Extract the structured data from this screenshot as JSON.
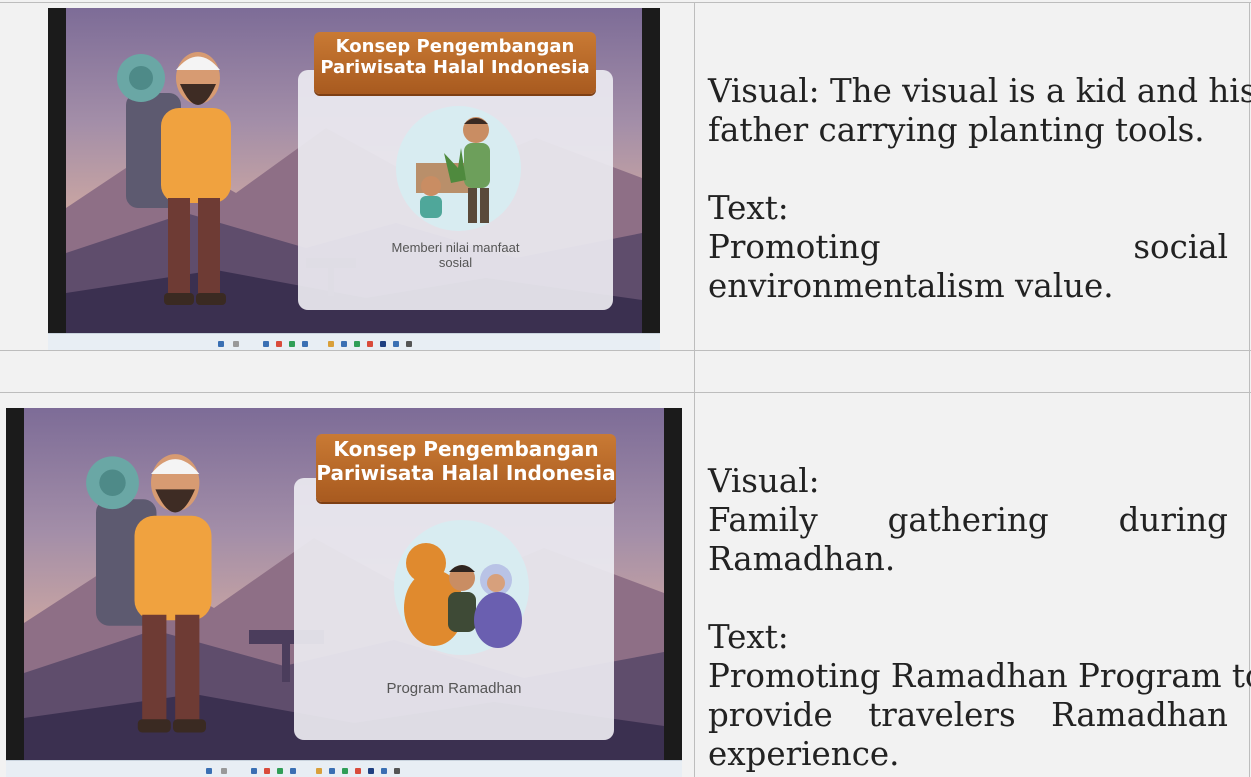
{
  "rows": [
    {
      "slide": {
        "banner_line1": "Konsep Pengembangan",
        "banner_line2": "Pariwisata Halal Indonesia",
        "caption_line1": "Memberi nilai manfaat",
        "caption_line2": "sosial",
        "illustration_icon": "father-and-kid-planting-illustration"
      },
      "description": {
        "visual_line1": "Visual: The visual is a kid and his",
        "visual_line2": "father carrying planting tools.",
        "text_heading": "Text:",
        "text_word1": "Promoting",
        "text_word2": "social",
        "text_line2": "environmentalism value."
      }
    },
    {
      "slide": {
        "banner_line1": "Konsep Pengembangan",
        "banner_line2": "Pariwisata Halal Indonesia",
        "caption_line1": "Program Ramadhan",
        "illustration_icon": "family-gathering-illustration"
      },
      "description": {
        "visual_heading": "Visual:",
        "visual_word1": "Family",
        "visual_word2": "gathering",
        "visual_word3": "during",
        "visual_line3": "Ramadhan.",
        "text_heading": "Text:",
        "text_line1": "Promoting Ramadhan Program to",
        "text_word1": "provide",
        "text_word2": "travelers",
        "text_word3": "Ramadhan",
        "text_line3": "experience."
      }
    }
  ],
  "colors": {
    "banner": "#b8682a",
    "card": "#ebe9f0",
    "sky": "#7d6c97"
  }
}
